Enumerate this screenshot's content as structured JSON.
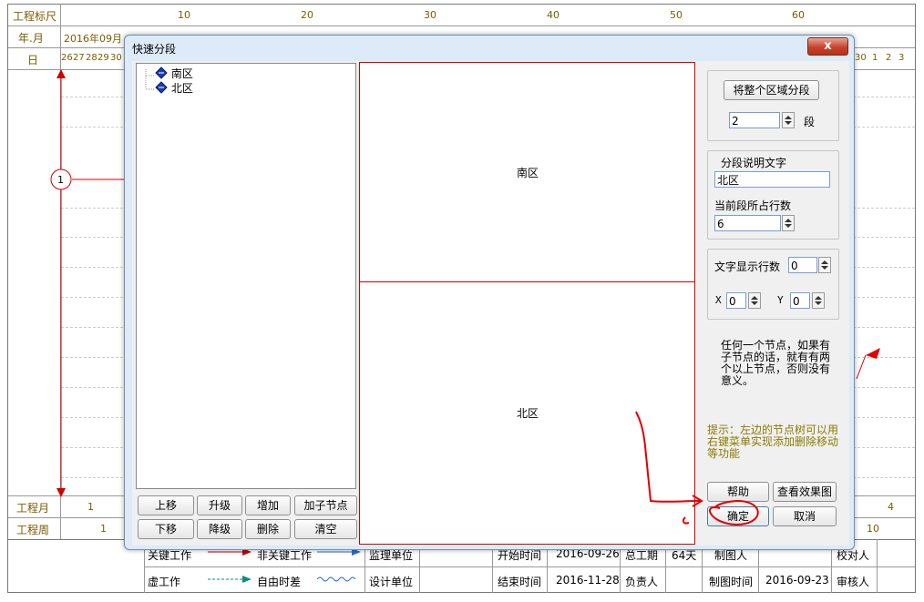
{
  "gantt": {
    "row_labels": {
      "ruler": "工程标尺",
      "yearmonth": "年.月",
      "day": "日",
      "project_month": "工程月",
      "project_week": "工程周"
    },
    "ruler_ticks": [
      "10",
      "20",
      "30",
      "40",
      "50",
      "60"
    ],
    "month_first": "2016年09月",
    "days_left": [
      "26",
      "27",
      "28",
      "29",
      "30"
    ],
    "days_right": [
      "30",
      "1",
      "2",
      "3"
    ],
    "node_label": "1",
    "project_month_values": [
      "1",
      "4"
    ],
    "project_week_values": [
      "1",
      "10"
    ],
    "legend": {
      "critical": "关键工作",
      "non_critical": "非关键工作",
      "dummy": "虚工作",
      "free_float": "自由时差",
      "supervisor": "监理单位",
      "design": "设计单位",
      "start_label": "开始时间",
      "start_value": "2016-09-26",
      "end_label": "结束时间",
      "end_value": "2016-11-28",
      "duration_label": "总工期",
      "duration_value": "64天",
      "responsible": "负责人",
      "drafter": "制图人",
      "draw_time_label": "制图时间",
      "draw_time_value": "2016-09-23",
      "checker": "校对人",
      "reviewer": "审核人"
    }
  },
  "dialog": {
    "title": "快速分段",
    "close_label": "x",
    "tree": [
      "南区",
      "北区"
    ],
    "preview_sections": [
      "南区",
      "北区"
    ],
    "buttons_left": {
      "up": "上移",
      "upgrade": "升级",
      "add": "增加",
      "add_child": "加子节点",
      "down": "下移",
      "downgrade": "降级",
      "delete": "删除",
      "clear": "清空"
    },
    "split_all_button": "将整个区域分段",
    "segment_count": "2",
    "segment_unit": "段",
    "desc_label": "分段说明文字",
    "desc_value": "北区",
    "rows_label": "当前段所占行数",
    "rows_value": "6",
    "text_rows_label": "文字显示行数",
    "text_rows_value": "0",
    "x_label": "X",
    "x_value": "0",
    "y_label": "Y",
    "y_value": "0",
    "note": "任何一个节点，如果有子节点的话，就有有两个以上节点，否则没有意义。",
    "hint": "提示：左边的节点树可以用右键菜单实现添加删除移动等功能",
    "help_button": "帮助",
    "preview_button": "查看效果图",
    "ok_button": "确定",
    "cancel_button": "取消"
  },
  "colors": {
    "accent_red": "#d00000",
    "label_gold": "#7a5c00",
    "dialog_bg": "#ddeaf7"
  }
}
